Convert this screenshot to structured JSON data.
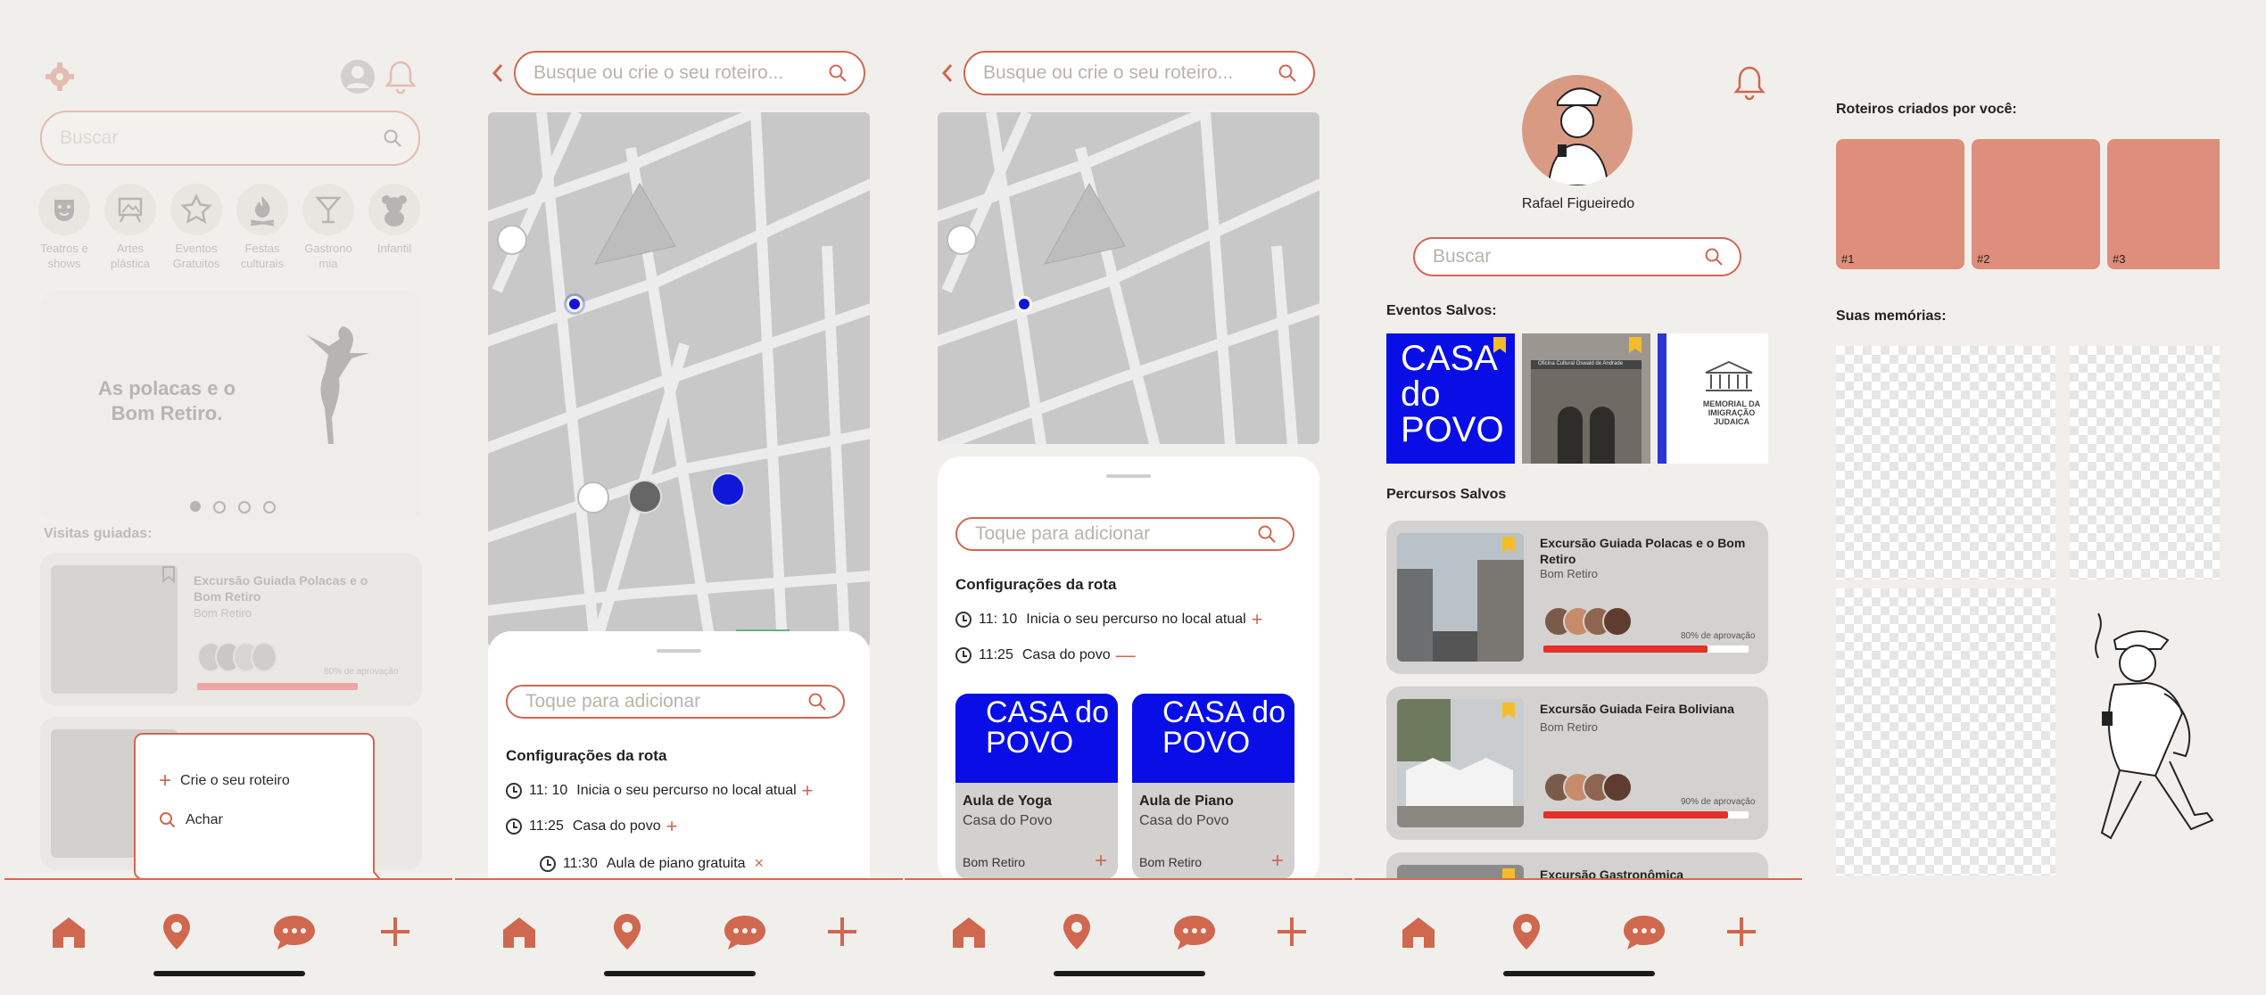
{
  "screen1": {
    "search_placeholder": "Buscar",
    "categories": [
      {
        "label": "Teatros e shows",
        "icon": "theater-mask-icon"
      },
      {
        "label": "Artes plástica",
        "icon": "easel-icon"
      },
      {
        "label": "Eventos Gratuitos",
        "icon": "star-icon"
      },
      {
        "label": "Festas culturais",
        "icon": "bonfire-icon"
      },
      {
        "label": "Gastrono mia",
        "icon": "cocktail-icon"
      },
      {
        "label": "Infantil",
        "icon": "teddy-bear-icon"
      }
    ],
    "banner_title": "As polacas e o Bom Retiro.",
    "section_title": "Visitas guiadas:",
    "tour_card_title": "Excursão Guiada Polacas e o Bom Retiro",
    "tour_card_place": "Bom Retiro",
    "tour_card_pct": "80% de aprovação",
    "popup": {
      "create": "Crie o seu roteiro",
      "find": "Achar"
    }
  },
  "screen2": {
    "search_placeholder": "Busque ou crie o seu roteiro...",
    "add_placeholder": "Toque para adicionar",
    "settings_title": "Configurações da rota",
    "rows": [
      {
        "time": "11: 10",
        "text": "Inicia o seu percurso no local atual",
        "mark": "+"
      },
      {
        "time": "11:25",
        "text": "Casa do povo",
        "mark": "+"
      },
      {
        "time": "11:30",
        "text": "Aula de piano gratuita",
        "mark": "×"
      }
    ]
  },
  "screen3": {
    "search_placeholder": "Busque ou crie o seu roteiro...",
    "add_placeholder": "Toque para adicionar",
    "settings_title": "Configurações da rota",
    "rows": [
      {
        "time": "11: 10",
        "text": "Inicia o seu percurso no local atual",
        "mark": "+"
      },
      {
        "time": "11:25",
        "text": "Casa do povo",
        "mark": "—"
      }
    ],
    "cards": [
      {
        "title": "Aula de Yoga",
        "venue": "Casa do Povo",
        "place": "Bom Retiro",
        "add": "+"
      },
      {
        "title": "Aula de Piano",
        "venue": "Casa do Povo",
        "place": "Bom Retiro",
        "add": "+"
      }
    ],
    "logo_text": "CASA do POVO"
  },
  "screen4": {
    "user_name": "Rafael Figueiredo",
    "search_placeholder": "Buscar",
    "saved_events_title": "Eventos Salvos:",
    "event2_caption": "Oficina Cultural Oswald de Andrade",
    "event3_caption": "MEMORIAL DA IMIGRAÇÃO JUDAICA",
    "saved_routes_title": "Percursos Salvos",
    "routes": [
      {
        "title": "Excursão Guiada Polacas e o Bom Retiro",
        "place": "Bom Retiro",
        "pct": "80% de aprovação",
        "approval": 0.8
      },
      {
        "title": "Excursão Guiada Feira Boliviana",
        "place": "Bom Retiro",
        "pct": "90% de aprovação",
        "approval": 0.9
      },
      {
        "title": "Excursão Gastronômica",
        "place": "",
        "pct": "",
        "approval": 0
      }
    ]
  },
  "screen5": {
    "created_title": "Roteiros criados por você:",
    "created": [
      "#1",
      "#2",
      "#3"
    ],
    "memories_title": "Suas memórias:"
  },
  "colors": {
    "accent": "#d0674f",
    "salmon": "#de8e7a",
    "casa_blue": "#0a0ee6",
    "bar_red": "#e3302a",
    "bookmark": "#f3bd2a"
  },
  "nav": [
    "home-icon",
    "map-pin-icon",
    "chat-icon",
    "plus-icon"
  ]
}
